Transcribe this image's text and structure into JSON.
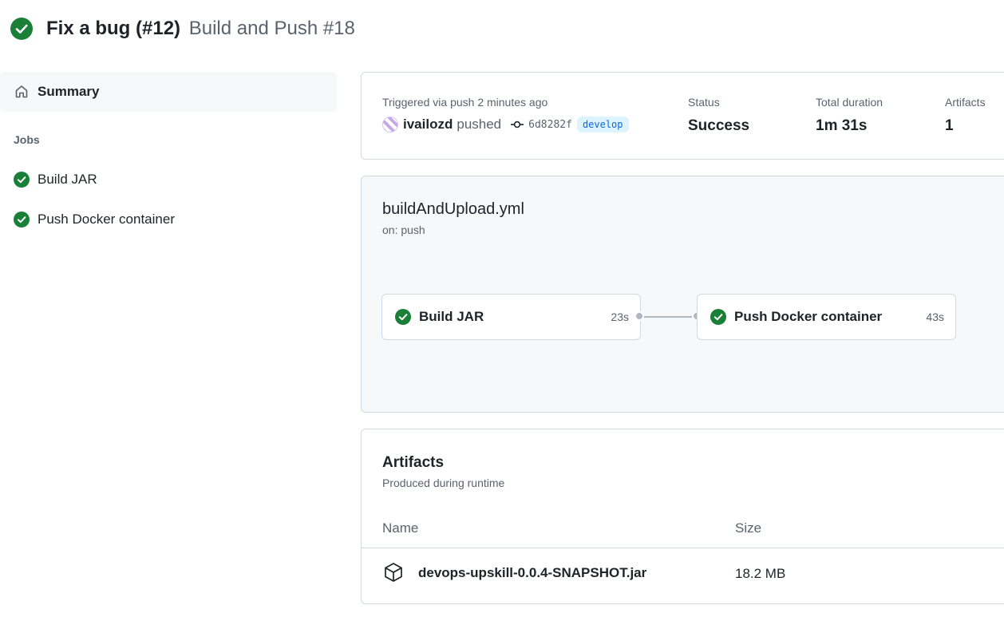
{
  "header": {
    "title": "Fix a bug (#12)",
    "subtitle": "Build and Push #18",
    "status_icon": "check-circle-fill"
  },
  "sidebar": {
    "summary_label": "Summary",
    "jobs_heading": "Jobs",
    "jobs": [
      {
        "label": "Build JAR",
        "status": "success"
      },
      {
        "label": "Push Docker container",
        "status": "success"
      }
    ]
  },
  "summary": {
    "trigger_text": "Triggered via push 2 minutes ago",
    "user": "ivailozd",
    "action": "pushed",
    "commit_sha": "6d8282f",
    "branch": "develop",
    "status_label": "Status",
    "status_value": "Success",
    "duration_label": "Total duration",
    "duration_value": "1m 31s",
    "artifacts_label": "Artifacts",
    "artifacts_value": "1"
  },
  "workflow": {
    "file": "buildAndUpload.yml",
    "trigger": "on: push",
    "jobs": [
      {
        "name": "Build JAR",
        "duration": "23s"
      },
      {
        "name": "Push Docker container",
        "duration": "43s"
      }
    ]
  },
  "artifacts": {
    "title": "Artifacts",
    "subtitle": "Produced during runtime",
    "columns": {
      "name": "Name",
      "size": "Size"
    },
    "items": [
      {
        "name": "devops-upskill-0.0.4-SNAPSHOT.jar",
        "size": "18.2 MB",
        "icon": "package-icon"
      }
    ]
  },
  "colors": {
    "success": "#1a7f37",
    "muted": "#59636e",
    "branch_bg": "#ddf4ff",
    "branch_fg": "#0969da"
  }
}
